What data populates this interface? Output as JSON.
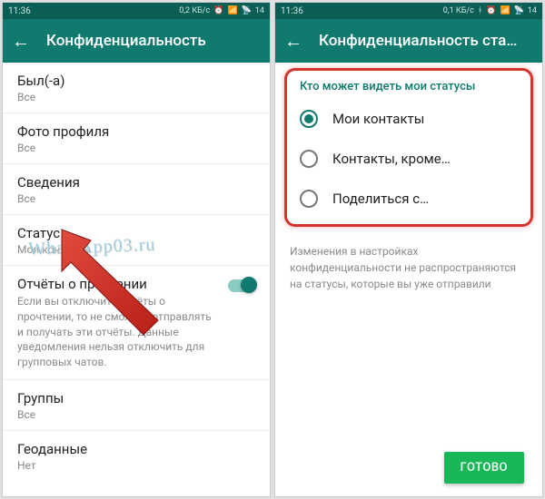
{
  "left": {
    "statusbar": {
      "time": "11:36",
      "net": "0,2 КБ/с",
      "battery": "14"
    },
    "appbar": {
      "title": "Конфиденциальность"
    },
    "items": {
      "last_seen": {
        "title": "Был(-а)",
        "sub": "Все"
      },
      "photo": {
        "title": "Фото профиля",
        "sub": "Все"
      },
      "about": {
        "title": "Сведения",
        "sub": "Все"
      },
      "status": {
        "title": "Статус",
        "sub": "Мои контакты"
      },
      "read": {
        "title": "Отчёты о прочтении",
        "desc": "Если вы отключите отчёты о прочтении, то не сможете отправлять и получать эти отчёты. Данные уведомления нельзя отключить для групповых чатов."
      },
      "groups": {
        "title": "Группы",
        "sub": "Все"
      },
      "geo": {
        "title": "Геоданные",
        "sub": "Нет"
      }
    }
  },
  "right": {
    "statusbar": {
      "time": "11:36",
      "net": "0,1 КБ/с",
      "battery": "14"
    },
    "appbar": {
      "title": "Конфиденциальность ста…"
    },
    "section_title": "Кто может видеть мои статусы",
    "radio": {
      "opt1": "Мои контакты",
      "opt2": "Контакты, кроме…",
      "opt3": "Поделиться с…"
    },
    "note": "Изменения в настройках конфиденциальности не распространяются на статусы, которые вы уже отправили",
    "done": "ГОТОВО"
  },
  "watermark": "WhatsApp03.ru"
}
